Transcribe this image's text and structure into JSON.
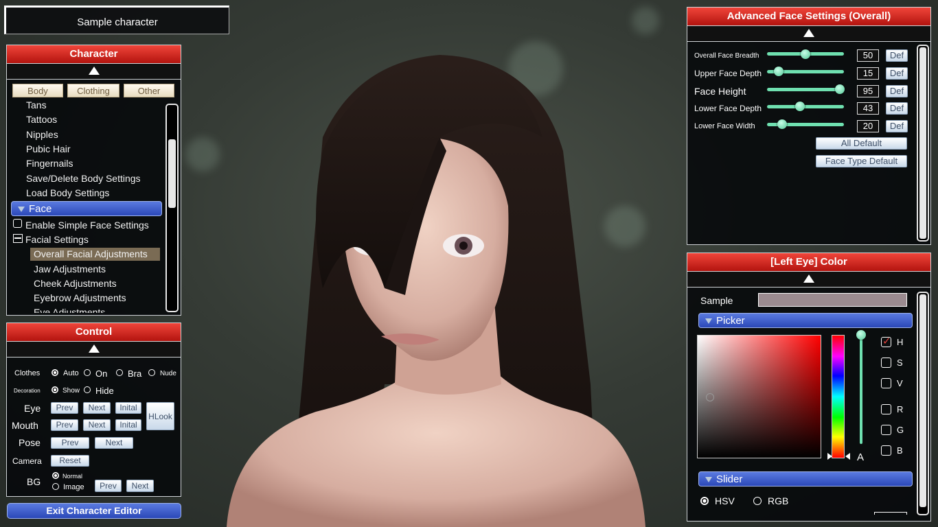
{
  "title_bar": {
    "label": "Sample character"
  },
  "character_panel": {
    "header": "Character",
    "tabs": [
      "Body",
      "Clothing",
      "Other"
    ],
    "items": [
      "Tans",
      "Tattoos",
      "Nipples",
      "Pubic Hair",
      "Fingernails",
      "Save/Delete Body Settings",
      "Load Body Settings"
    ],
    "face_section": "Face",
    "simple_face_checkbox": "Enable Simple Face Settings",
    "facial_settings_group": "Facial Settings",
    "sub_items": [
      "Overall Facial Adjustments",
      "Jaw Adjustments",
      "Cheek Adjustments",
      "Eyebrow Adjustments",
      "Eye Adjustments"
    ],
    "selected_sub_item": "Overall Facial Adjustments"
  },
  "control_panel": {
    "header": "Control",
    "clothes": {
      "label": "Clothes",
      "options": [
        "Auto",
        "On",
        "Bra",
        "Nude"
      ],
      "selected": "Auto"
    },
    "decoration": {
      "label": "Decoration",
      "options": [
        "Show",
        "Hide"
      ],
      "selected": "Show"
    },
    "eye": {
      "label": "Eye",
      "prev": "Prev",
      "next": "Next",
      "initial": "Inital"
    },
    "mouth": {
      "label": "Mouth",
      "prev": "Prev",
      "next": "Next",
      "initial": "Inital"
    },
    "hlook": "HLook",
    "pose": {
      "label": "Pose",
      "prev": "Prev",
      "next": "Next"
    },
    "camera": {
      "label": "Camera",
      "reset": "Reset"
    },
    "bg": {
      "label": "BG",
      "options": [
        "Normal",
        "Image"
      ],
      "selected": "Normal",
      "prev": "Prev",
      "next": "Next"
    }
  },
  "exit_button": "Exit Character Editor",
  "advanced_face": {
    "header": "Advanced Face Settings (Overall)",
    "sliders": [
      {
        "label": "Overall Face Breadth",
        "value": 50
      },
      {
        "label": "Upper Face Depth",
        "value": 15
      },
      {
        "label": "Face Height",
        "value": 95
      },
      {
        "label": "Lower Face Depth",
        "value": 43
      },
      {
        "label": "Lower Face Width",
        "value": 20
      }
    ],
    "def_label": "Def",
    "all_default": "All Default",
    "face_type_default": "Face Type Default"
  },
  "eye_color": {
    "header": "[Left Eye] Color",
    "sample_label": "Sample",
    "picker_label": "Picker",
    "alpha_label": "A",
    "channels": [
      "H",
      "S",
      "V",
      "R",
      "G",
      "B"
    ],
    "checked_channel": "H",
    "slider_label": "Slider",
    "modes": [
      "HSV",
      "RGB"
    ],
    "selected_mode": "HSV"
  }
}
